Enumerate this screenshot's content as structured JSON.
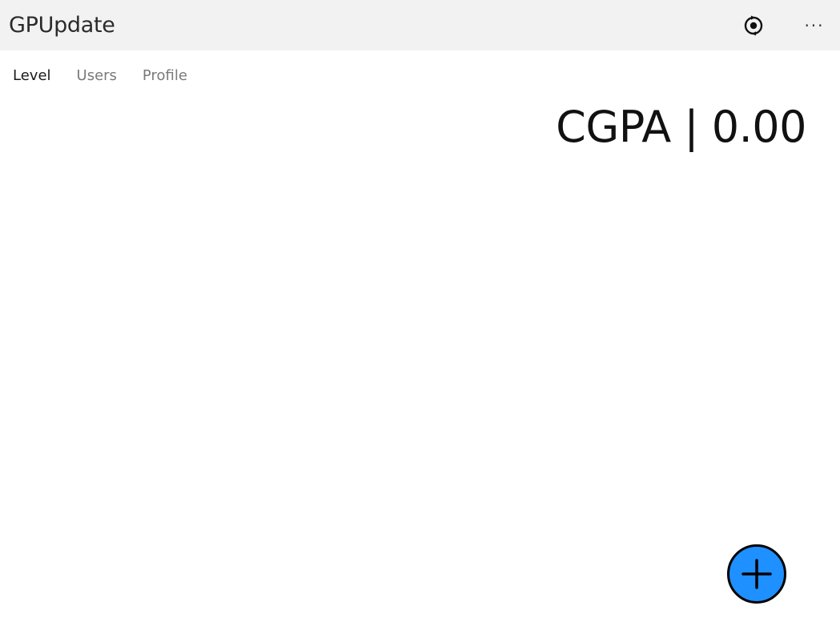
{
  "app": {
    "title": "GPUpdate"
  },
  "titlebar": {
    "sync_icon": "sync-circle-icon",
    "more_label": "···"
  },
  "tabs": [
    {
      "label": "Level",
      "active": true
    },
    {
      "label": "Users",
      "active": false
    },
    {
      "label": "Profile",
      "active": false
    }
  ],
  "summary": {
    "cgpa_text": "CGPA | 0.00"
  },
  "fab": {
    "icon": "plus-icon",
    "color": "#1e90ff"
  },
  "colors": {
    "titlebar_bg": "#f2f2f2",
    "accent": "#1e90ff"
  }
}
